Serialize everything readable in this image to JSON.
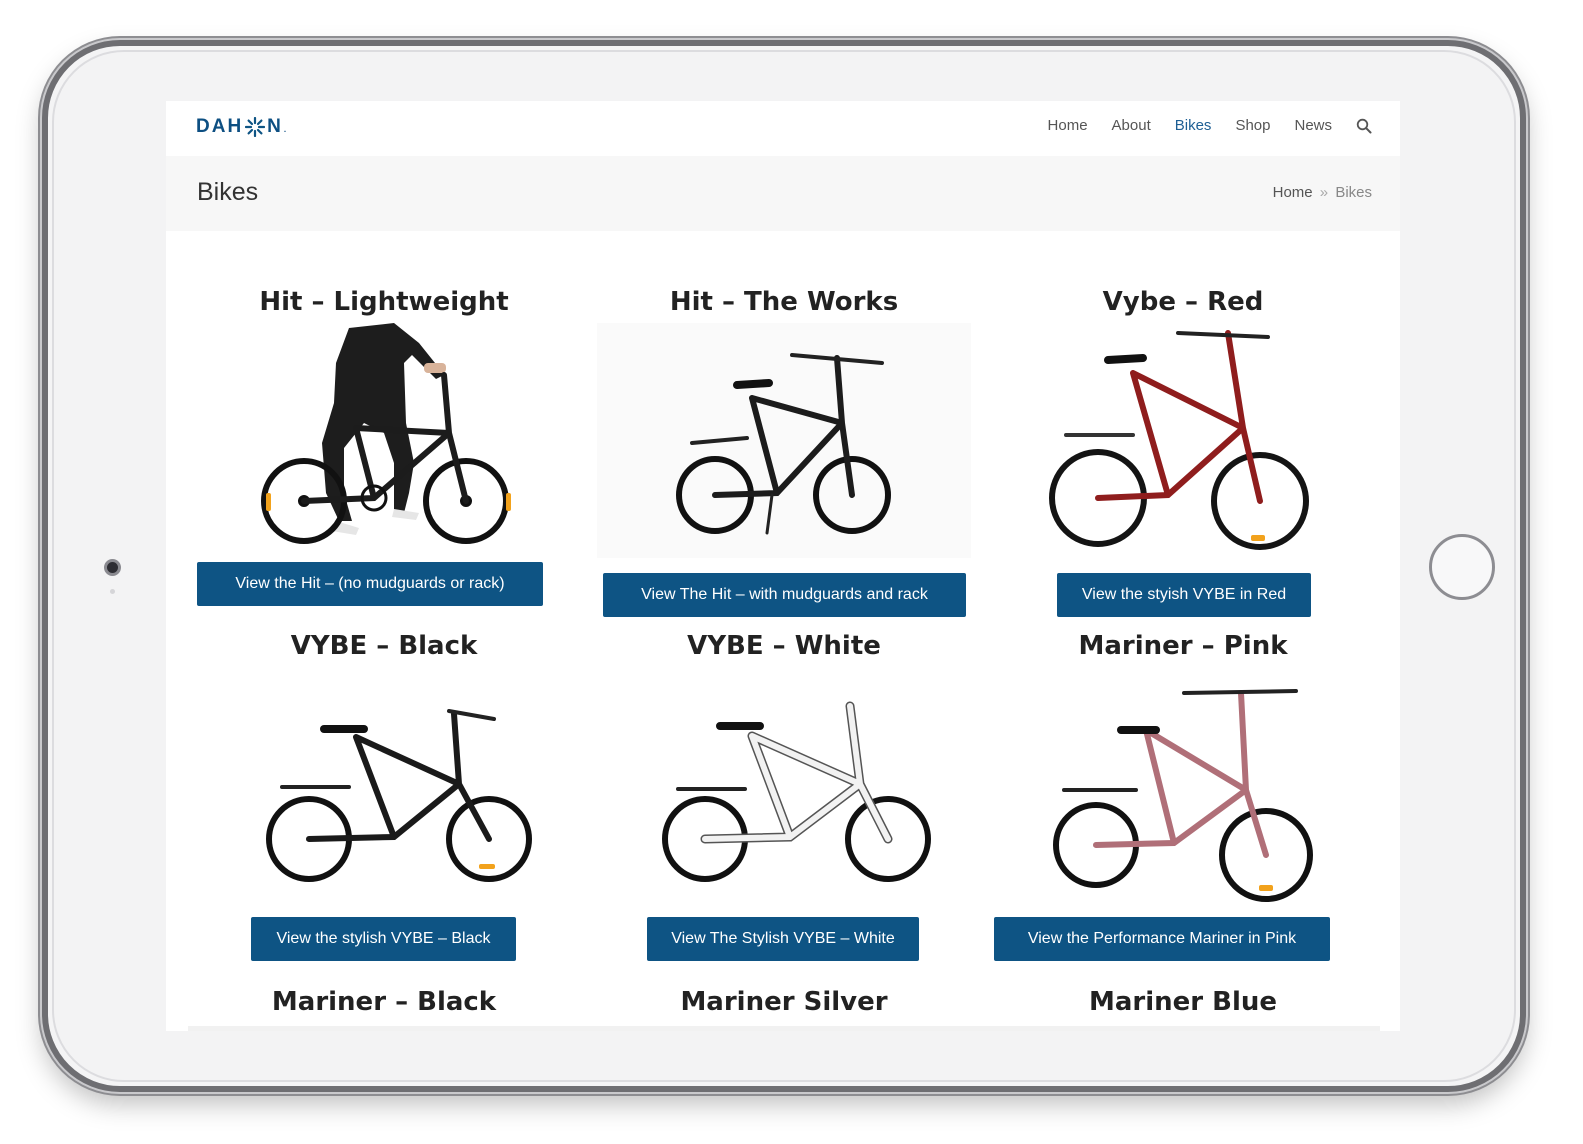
{
  "brand": {
    "logo_text_left": "DAH",
    "logo_text_right": "N",
    "accent": "#0e5484"
  },
  "nav": {
    "items": [
      {
        "label": "Home",
        "active": false
      },
      {
        "label": "About",
        "active": false
      },
      {
        "label": "Bikes",
        "active": true
      },
      {
        "label": "Shop",
        "active": false
      },
      {
        "label": "News",
        "active": false
      }
    ],
    "search_icon": "search-icon"
  },
  "page": {
    "title": "Bikes",
    "breadcrumb": {
      "home": "Home",
      "separator": "»",
      "current": "Bikes"
    }
  },
  "products": [
    {
      "title": "Hit – Lightweight",
      "button": "View the Hit – (no mudguards or rack)",
      "frame_color": "#1c1c1c"
    },
    {
      "title": "Hit – The Works",
      "button": "View The Hit – with mudguards and rack",
      "frame_color": "#1c1c1c"
    },
    {
      "title": "Vybe – Red",
      "button": "View the styish VYBE in Red",
      "frame_color": "#8f1d1d"
    },
    {
      "title": "VYBE – Black",
      "button": "View the stylish VYBE – Black",
      "frame_color": "#1a1a1a"
    },
    {
      "title": "VYBE – White",
      "button": "View The Stylish VYBE – White",
      "frame_color": "#f2f2f2"
    },
    {
      "title": "Mariner – Pink",
      "button": "View the Performance Mariner in Pink",
      "frame_color": "#b06f78"
    },
    {
      "title": "Mariner – Black",
      "button": "",
      "frame_color": "#1a1a1a"
    },
    {
      "title": "Mariner Silver",
      "button": "",
      "frame_color": "#c0c0c0"
    },
    {
      "title": "Mariner Blue",
      "button": "",
      "frame_color": "#2a4e8a"
    }
  ]
}
